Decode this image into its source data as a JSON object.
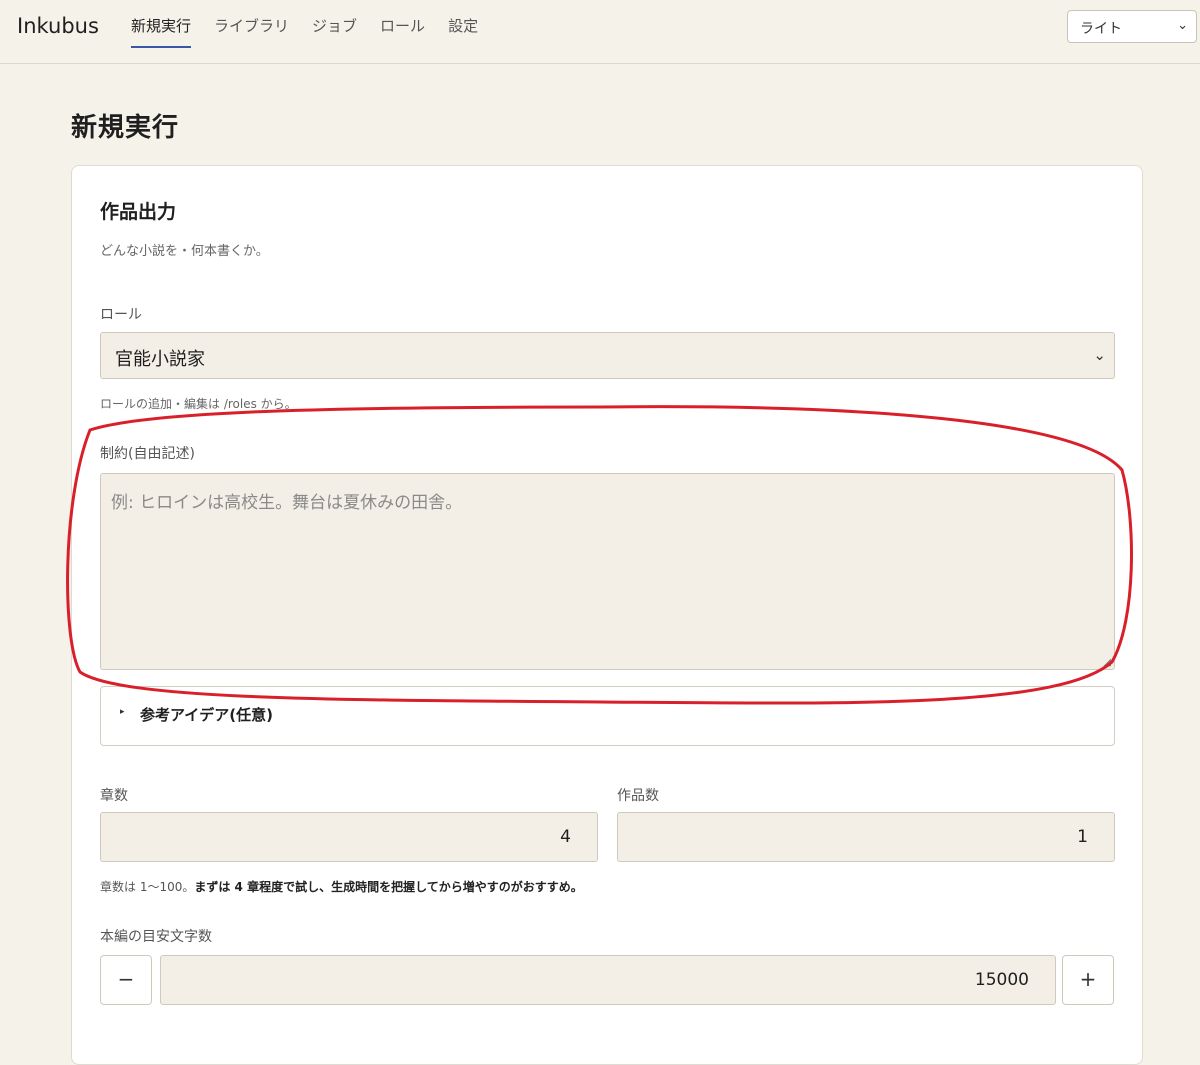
{
  "app": {
    "name": "Inkubus",
    "nav": [
      "新規実行",
      "ライブラリ",
      "ジョブ",
      "ロール",
      "設定"
    ],
    "theme_value": "ライト"
  },
  "page": {
    "title": "新規実行"
  },
  "section": {
    "title": "作品出力",
    "description": "どんな小説を・何本書くか。"
  },
  "role": {
    "label": "ロール",
    "value": "官能小説家",
    "hint": "ロールの追加・編集は /roles から。"
  },
  "constraints": {
    "label": "制約(自由記述)",
    "placeholder": "例: ヒロインは高校生。舞台は夏休みの田舎。"
  },
  "reference": {
    "summary": "参考アイデア(任意)"
  },
  "chapters": {
    "label": "章数",
    "value": "4"
  },
  "works": {
    "label": "作品数",
    "value": "1"
  },
  "chapters_hint": {
    "prefix": "章数は 1〜100。",
    "bold": "まずは 4 章程度で試し、生成時間を把握してから増やすのがおすすめ。"
  },
  "char_count": {
    "label": "本編の目安文字数",
    "value": "15000",
    "minus": "−",
    "plus": "+"
  },
  "colors": {
    "accent": "#3a56a8",
    "annotation": "#d9202a",
    "input_bg": "#f3efe6",
    "page_bg": "#f5f2ea"
  },
  "icons": {
    "select_chevron": "chevron-down-icon",
    "details_marker": "triangle-right-icon",
    "resize": "resize-grip-icon"
  }
}
